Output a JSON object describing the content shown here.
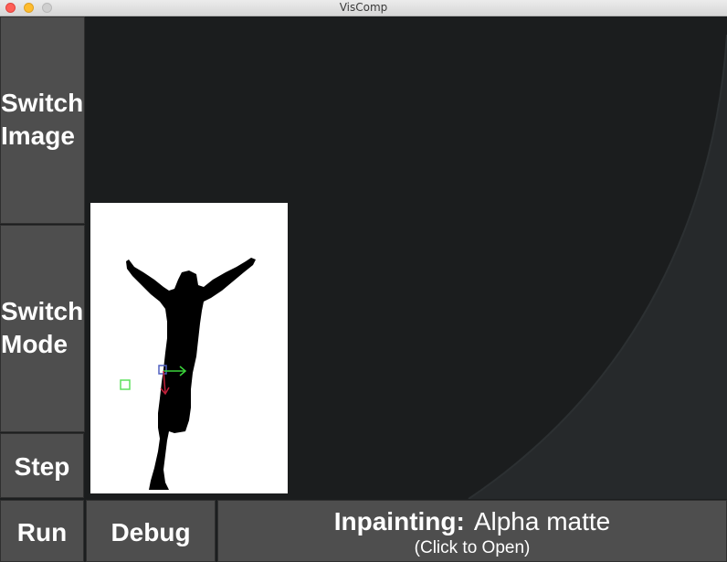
{
  "window": {
    "title": "VisComp"
  },
  "buttons": {
    "switch_image_line1": "Switch",
    "switch_image_line2": "Image",
    "switch_mode_line1": "Switch",
    "switch_mode_line2": "Mode",
    "step": "Step",
    "run": "Run",
    "debug": "Debug"
  },
  "inpainting": {
    "label": "Inpainting:",
    "value": "Alpha matte",
    "hint": "(Click to Open)"
  },
  "colors": {
    "background": "#1b1d1e",
    "button_face": "#4e4e4e",
    "axis_x": "#3ad43a",
    "axis_y": "#c0203a",
    "axis_origin": "#5060c0",
    "marker": "#5fe05f"
  },
  "matte": {
    "icons": [
      "silhouette-figure",
      "axis-gizmo-icon",
      "green-square-marker"
    ]
  }
}
